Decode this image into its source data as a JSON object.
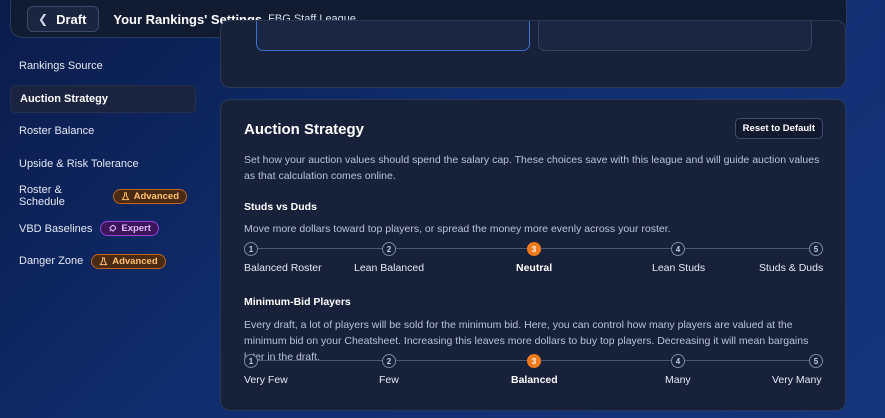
{
  "header": {
    "back_label": "Draft",
    "title": "Your Rankings' Settings",
    "league": "FBG Staff League"
  },
  "sidebar": {
    "items": [
      {
        "label": "Rankings Source",
        "badge": null
      },
      {
        "label": "Auction Strategy",
        "badge": null,
        "active": true
      },
      {
        "label": "Roster Balance",
        "badge": null
      },
      {
        "label": "Upside & Risk Tolerance",
        "badge": null
      },
      {
        "label": "Roster & Schedule",
        "badge": "Advanced"
      },
      {
        "label": "VBD Baselines",
        "badge": "Expert"
      },
      {
        "label": "Danger Zone",
        "badge": "Advanced"
      }
    ]
  },
  "main": {
    "card_title": "Auction Strategy",
    "reset_label": "Reset to Default",
    "description": "Set how your auction values should spend the salary cap. These choices save with this league and will guide auction values as that calculation comes online.",
    "studs": {
      "title": "Studs vs Duds",
      "description": "Move more dollars toward top players, or spread the money more evenly across your roster.",
      "steps": [
        "1",
        "2",
        "3",
        "4",
        "5"
      ],
      "labels": [
        "Balanced Roster",
        "Lean Balanced",
        "Neutral",
        "Lean Studs",
        "Studs & Duds"
      ],
      "selected": 3
    },
    "minbid": {
      "title": "Minimum-Bid Players",
      "description": "Every draft, a lot of players will be sold for the minimum bid. Here, you can control how many players are valued at the minimum bid on your Cheatsheet. Increasing this leaves more dollars to buy top players. Decreasing it will mean bargains later in the draft.",
      "steps": [
        "1",
        "2",
        "3",
        "4",
        "5"
      ],
      "labels": [
        "Very Few",
        "Few",
        "Balanced",
        "Many",
        "Very Many"
      ],
      "selected": 3
    }
  },
  "colors": {
    "accent": "#f07a1c",
    "advanced_badge": "#ffc06a",
    "expert_badge": "#e4b8ff"
  },
  "icons": {
    "back": "chevron-left-icon",
    "advanced": "flask-icon",
    "expert": "rocket-icon"
  }
}
